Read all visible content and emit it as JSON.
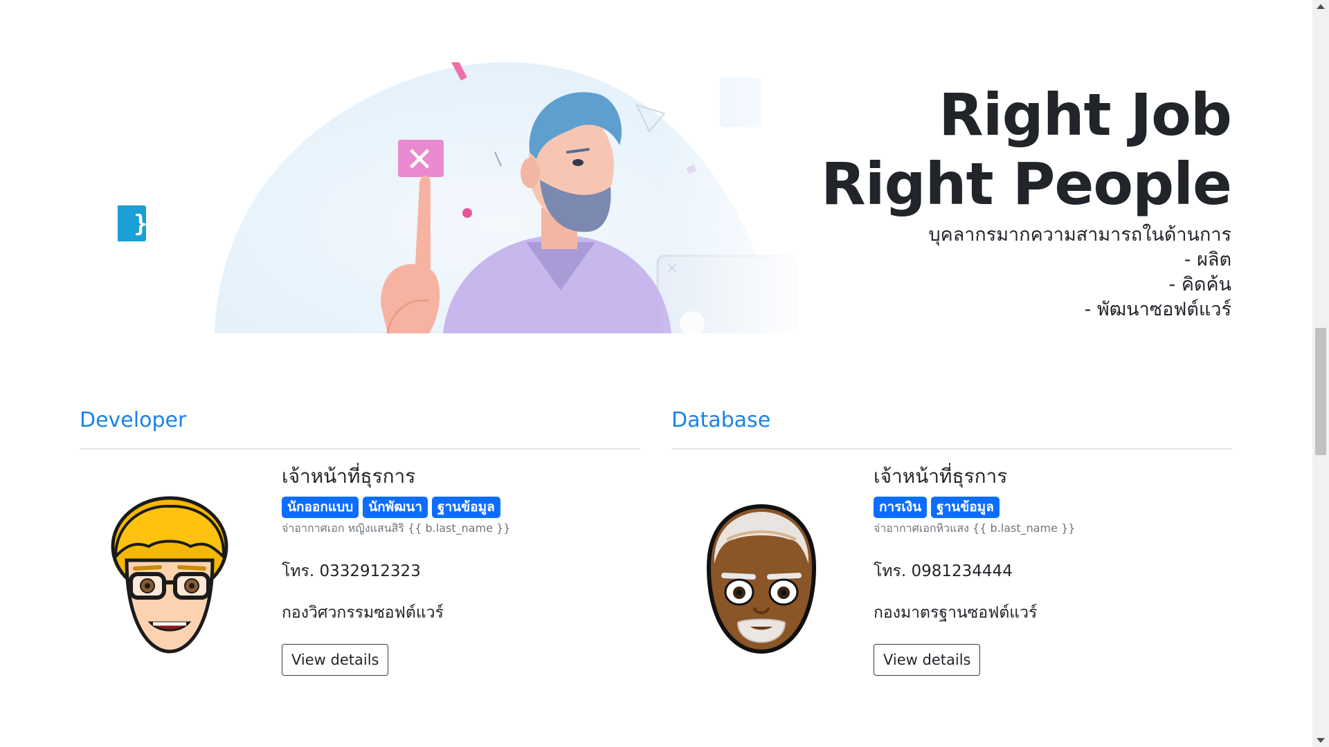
{
  "hero": {
    "title_line1": "Right Job",
    "title_line2": "Right People",
    "subtitle_lines": [
      "บุคลากรมากความสามารถในด้านการ",
      "- ผลิต",
      "- คิดค้น",
      "- พัฒนาซอฟต์แวร์"
    ],
    "illustration": "developer-pointing-illustration"
  },
  "sections": [
    {
      "heading": "Developer",
      "card": {
        "role": "เจ้าหน้าที่ธุรการ",
        "tags": [
          "นักออกแบบ",
          "นักพัฒนา",
          "ฐานข้อมูล"
        ],
        "name_line": "จ่าอากาศเอก หญิงแสนสิริ {{ b.last_name }}",
        "phone": "โทร. 0332912323",
        "department": "กองวิศวกรรมซอฟต์แวร์",
        "button_label": "View details",
        "avatar": "blond-glasses-man-avatar"
      }
    },
    {
      "heading": "Database",
      "card": {
        "role": "เจ้าหน้าที่ธุรการ",
        "tags": [
          "การเงิน",
          "ฐานข้อมูล"
        ],
        "name_line": "จ่าอากาศเอกหิวแสง {{ b.last_name }}",
        "phone": "โทร. 0981234444",
        "department": "กองมาตรฐานซอฟต์แวร์",
        "button_label": "View details",
        "avatar": "bearded-bald-man-avatar"
      }
    }
  ],
  "colors": {
    "accent": "#1a82ea",
    "badge": "#0d6efd",
    "text": "#212529",
    "muted": "#6c757d"
  }
}
